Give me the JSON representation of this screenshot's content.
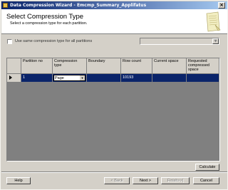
{
  "window": {
    "title": "Data Compression Wizard - Emcmp_Summary_Applifatus"
  },
  "header": {
    "title": "Select Compression Type",
    "subtitle": "Select a compression type for each partition."
  },
  "options": {
    "same_type_label": "Use same compression type for all partitions",
    "same_type_checked": false,
    "combo_value": ""
  },
  "grid": {
    "columns": [
      "Partition no",
      "Compression type",
      "Boundary",
      "Row count",
      "Current space",
      "Requested compressed space"
    ],
    "rows": [
      {
        "partition": "1",
        "compression": "Page",
        "boundary": "",
        "row_count": "10193",
        "current_space": "",
        "requested_space": ""
      }
    ]
  },
  "buttons": {
    "calculate": "Calculate",
    "help": "Help",
    "back": "< Back",
    "next": "Next >",
    "finish": "Finish>>|",
    "cancel": "Cancel"
  },
  "colors": {
    "title_bar": "#0a246a",
    "selection": "#0a246a",
    "face": "#d4d0c8"
  }
}
